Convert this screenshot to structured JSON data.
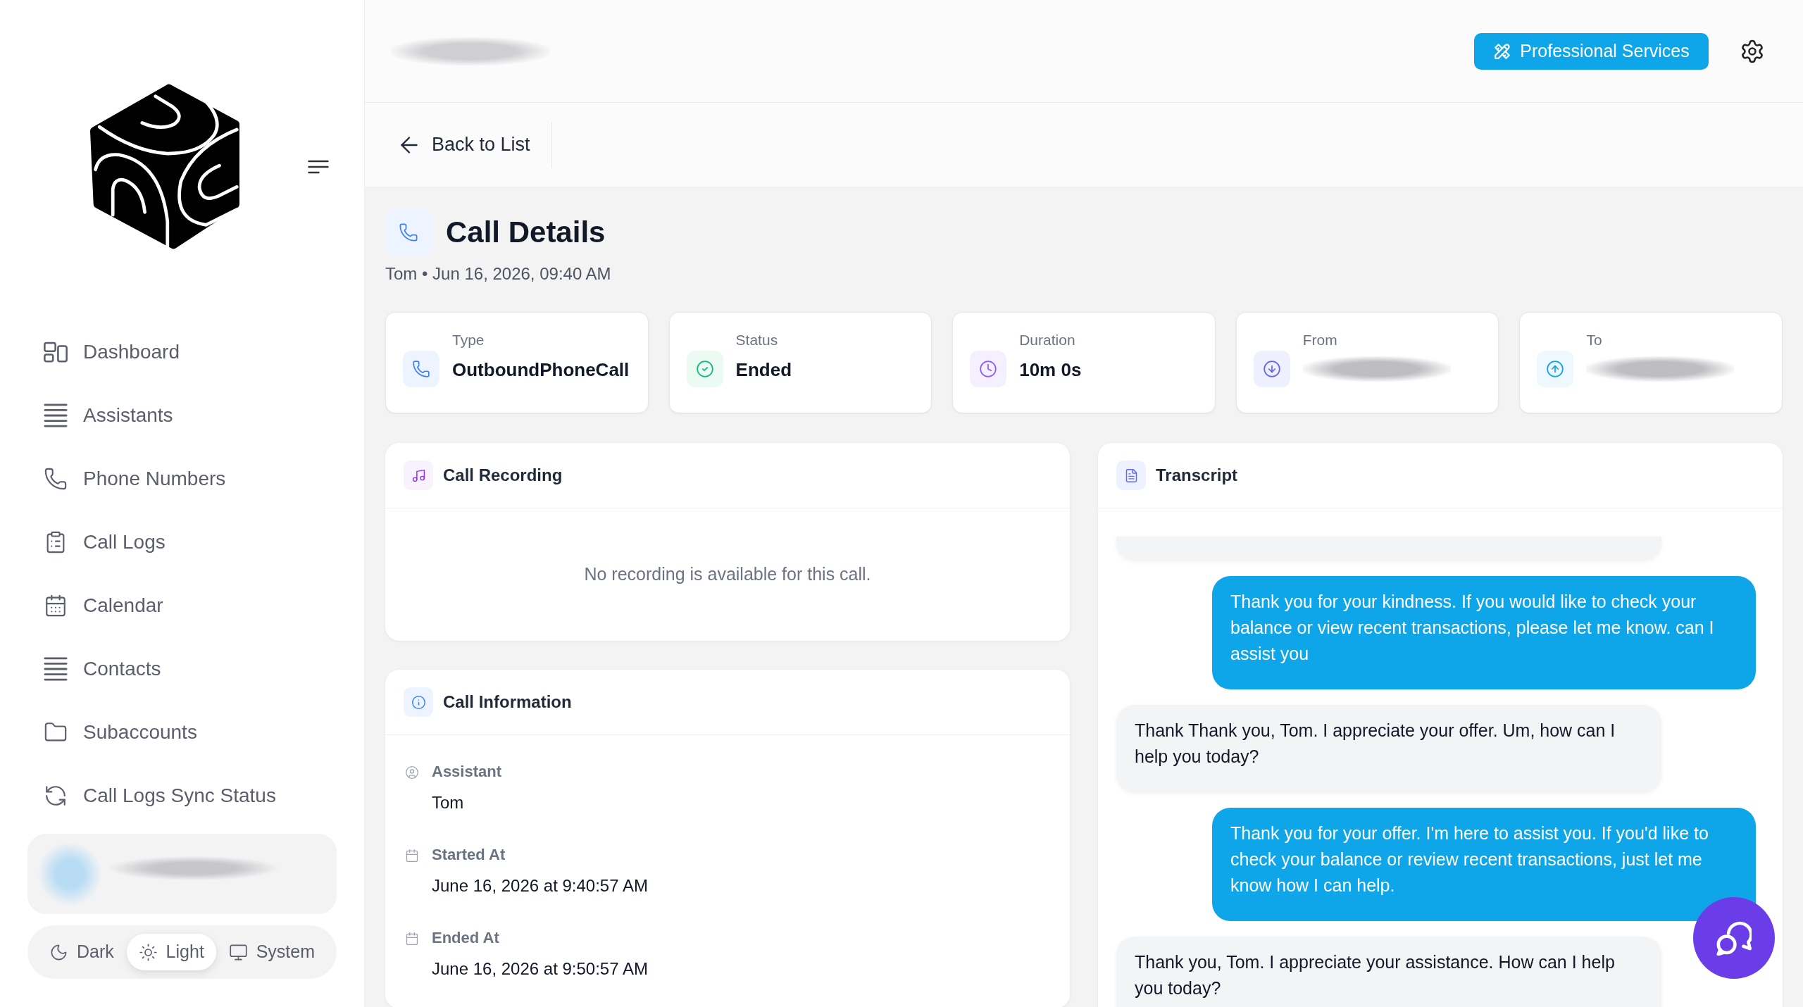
{
  "sidebar": {
    "nav": [
      {
        "label": "Dashboard"
      },
      {
        "label": "Assistants"
      },
      {
        "label": "Phone Numbers"
      },
      {
        "label": "Call Logs"
      },
      {
        "label": "Calendar"
      },
      {
        "label": "Contacts"
      },
      {
        "label": "Subaccounts"
      },
      {
        "label": "Call Logs Sync Status"
      }
    ],
    "theme": [
      {
        "label": "Dark",
        "selected": false
      },
      {
        "label": "Light",
        "selected": true
      },
      {
        "label": "System",
        "selected": false
      }
    ]
  },
  "header": {
    "button": "Professional Services"
  },
  "back_link": "Back to List",
  "page": {
    "title": "Call Details",
    "subtitle": "Tom • Jun 16, 2026, 09:40 AM"
  },
  "stats": [
    {
      "label": "Type",
      "value": "OutboundPhoneCall",
      "redacted": false
    },
    {
      "label": "Status",
      "value": "Ended",
      "redacted": false
    },
    {
      "label": "Duration",
      "value": "10m 0s",
      "redacted": false
    },
    {
      "label": "From",
      "redacted": true
    },
    {
      "label": "To",
      "redacted": true
    }
  ],
  "recording": {
    "title": "Call Recording",
    "message": "No recording is available for this call."
  },
  "call_information": {
    "title": "Call Information",
    "fields": [
      {
        "label": "Assistant",
        "value": "Tom"
      },
      {
        "label": "Started At",
        "value": "June 16, 2026 at 9:40:57 AM"
      },
      {
        "label": "Ended At",
        "value": "June 16, 2026 at 9:50:57 AM"
      }
    ]
  },
  "transcript": {
    "title": "Transcript",
    "messages": [
      {
        "kind": "assistant",
        "text": "Thank you for your kindness. If you would like to check your balance or view recent transactions, please let me know. can I assist you"
      },
      {
        "kind": "user",
        "text": "Thank Thank you, Tom. I appreciate your offer. Um, how can I help you today?"
      },
      {
        "kind": "assistant",
        "text": "Thank you for your offer. I'm here to assist you. If you'd like to check your balance or review recent transactions, just let me know how I can help."
      },
      {
        "kind": "user",
        "text": "Thank you, Tom. I appreciate your assistance. How can I help you today?"
      }
    ]
  }
}
